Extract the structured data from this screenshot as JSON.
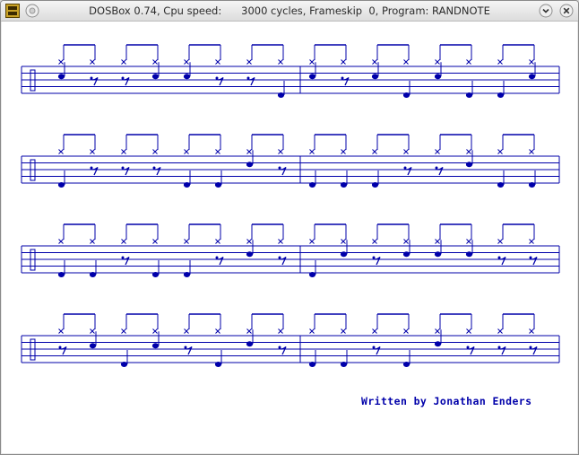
{
  "window": {
    "title": "DOSBox 0.74, Cpu speed:      3000 cycles, Frameskip  0, Program: RANDNOTE",
    "icon": "dosbox-icon",
    "buttons": [
      "menu-icon",
      "minimize-icon",
      "close-icon"
    ]
  },
  "app": {
    "credit": "Written by Jonathan Enders",
    "ink_color": "#0000aa",
    "background": "#ffffff"
  },
  "score": {
    "staves": [
      {
        "measures": [
          {
            "notes": [
              "snare",
              "rest",
              "rest",
              "snare",
              "snare",
              "rest",
              "rest",
              "bass"
            ]
          },
          {
            "notes": [
              "snare",
              "rest",
              "snare",
              "bass",
              "snare",
              "bass",
              "bass",
              "snare"
            ]
          }
        ]
      },
      {
        "measures": [
          {
            "notes": [
              "bass",
              "rest",
              "rest",
              "rest",
              "bass",
              "bass",
              "high",
              "rest"
            ]
          },
          {
            "notes": [
              "bass",
              "bass",
              "bass",
              "rest",
              "rest",
              "high",
              "bass",
              "bass"
            ]
          }
        ]
      },
      {
        "measures": [
          {
            "notes": [
              "bass",
              "bass",
              "rest",
              "bass",
              "bass",
              "rest",
              "high",
              "rest"
            ]
          },
          {
            "notes": [
              "bass",
              "high",
              "rest",
              "high",
              "high",
              "high",
              "rest",
              "rest"
            ]
          }
        ]
      },
      {
        "measures": [
          {
            "notes": [
              "rest",
              "snare",
              "bass",
              "snare",
              "rest",
              "bass",
              "high",
              "rest"
            ]
          },
          {
            "notes": [
              "bass",
              "bass",
              "rest",
              "bass",
              "high",
              "rest",
              "rest",
              "rest"
            ]
          }
        ]
      }
    ]
  }
}
